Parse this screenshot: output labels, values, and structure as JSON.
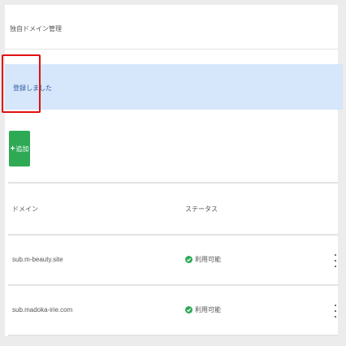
{
  "header": {
    "title": "独自ドメイン管理"
  },
  "alert": {
    "message": "登録しました"
  },
  "toolbar": {
    "add_label": "追加",
    "add_icon": "plus-icon"
  },
  "table": {
    "columns": [
      "ドメイン",
      "ステータス"
    ],
    "rows": [
      {
        "domain": "sub.m-beauty.site",
        "status": "利用可能"
      },
      {
        "domain": "sub.madoka-irie.com",
        "status": "利用可能"
      }
    ]
  },
  "colors": {
    "alert_bg": "#d6e6fb",
    "success": "#2eaa55",
    "highlight": "#e01010"
  }
}
